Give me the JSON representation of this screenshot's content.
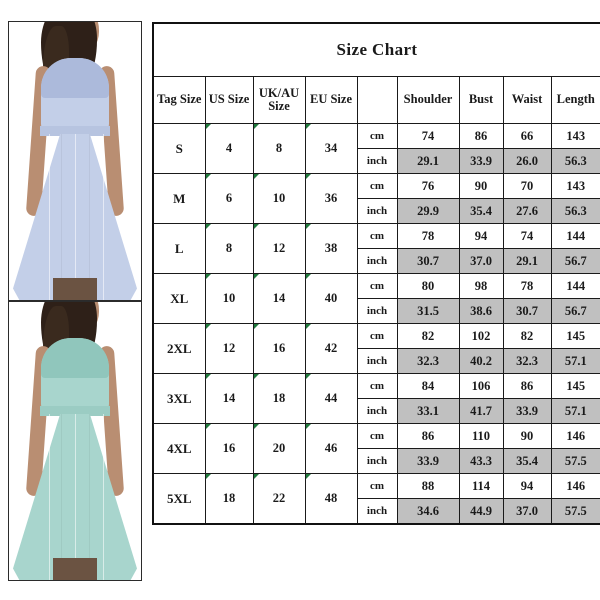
{
  "photos": [
    {
      "name": "dress-photo-blue",
      "color": "#c3cfe8",
      "lace_color": "#a8b6d8",
      "alt": "Model wearing light blue lace chiffon maxi dress"
    },
    {
      "name": "dress-photo-mint",
      "color": "#a8d5cd",
      "lace_color": "#8cc3b9",
      "alt": "Model wearing mint green lace chiffon maxi dress"
    }
  ],
  "chart": {
    "title": "Size Chart",
    "headers": {
      "tag_size": "Tag Size",
      "us_size": "US Size",
      "uk_au_size_line1": "UK/AU",
      "uk_au_size_line2": "Size",
      "eu_size": "EU Size",
      "unit": "",
      "shoulder": "Shoulder",
      "bust": "Bust",
      "waist": "Waist",
      "length": "Length"
    },
    "units": {
      "cm": "cm",
      "inch": "inch"
    },
    "accent_gray": "#c0c0c0",
    "marker_color": "#1f7a3d",
    "rows": [
      {
        "tag": "S",
        "us": "4",
        "uk": "8",
        "eu": "34",
        "cm": {
          "shoulder": "74",
          "bust": "86",
          "waist": "66",
          "length": "143"
        },
        "inch": {
          "shoulder": "29.1",
          "bust": "33.9",
          "waist": "26.0",
          "length": "56.3"
        }
      },
      {
        "tag": "M",
        "us": "6",
        "uk": "10",
        "eu": "36",
        "cm": {
          "shoulder": "76",
          "bust": "90",
          "waist": "70",
          "length": "143"
        },
        "inch": {
          "shoulder": "29.9",
          "bust": "35.4",
          "waist": "27.6",
          "length": "56.3"
        }
      },
      {
        "tag": "L",
        "us": "8",
        "uk": "12",
        "eu": "38",
        "cm": {
          "shoulder": "78",
          "bust": "94",
          "waist": "74",
          "length": "144"
        },
        "inch": {
          "shoulder": "30.7",
          "bust": "37.0",
          "waist": "29.1",
          "length": "56.7"
        }
      },
      {
        "tag": "XL",
        "us": "10",
        "uk": "14",
        "eu": "40",
        "cm": {
          "shoulder": "80",
          "bust": "98",
          "waist": "78",
          "length": "144"
        },
        "inch": {
          "shoulder": "31.5",
          "bust": "38.6",
          "waist": "30.7",
          "length": "56.7"
        }
      },
      {
        "tag": "2XL",
        "us": "12",
        "uk": "16",
        "eu": "42",
        "cm": {
          "shoulder": "82",
          "bust": "102",
          "waist": "82",
          "length": "145"
        },
        "inch": {
          "shoulder": "32.3",
          "bust": "40.2",
          "waist": "32.3",
          "length": "57.1"
        }
      },
      {
        "tag": "3XL",
        "us": "14",
        "uk": "18",
        "eu": "44",
        "cm": {
          "shoulder": "84",
          "bust": "106",
          "waist": "86",
          "length": "145"
        },
        "inch": {
          "shoulder": "33.1",
          "bust": "41.7",
          "waist": "33.9",
          "length": "57.1"
        }
      },
      {
        "tag": "4XL",
        "us": "16",
        "uk": "20",
        "eu": "46",
        "cm": {
          "shoulder": "86",
          "bust": "110",
          "waist": "90",
          "length": "146"
        },
        "inch": {
          "shoulder": "33.9",
          "bust": "43.3",
          "waist": "35.4",
          "length": "57.5"
        }
      },
      {
        "tag": "5XL",
        "us": "18",
        "uk": "22",
        "eu": "48",
        "cm": {
          "shoulder": "88",
          "bust": "114",
          "waist": "94",
          "length": "146"
        },
        "inch": {
          "shoulder": "34.6",
          "bust": "44.9",
          "waist": "37.0",
          "length": "57.5"
        }
      }
    ]
  }
}
